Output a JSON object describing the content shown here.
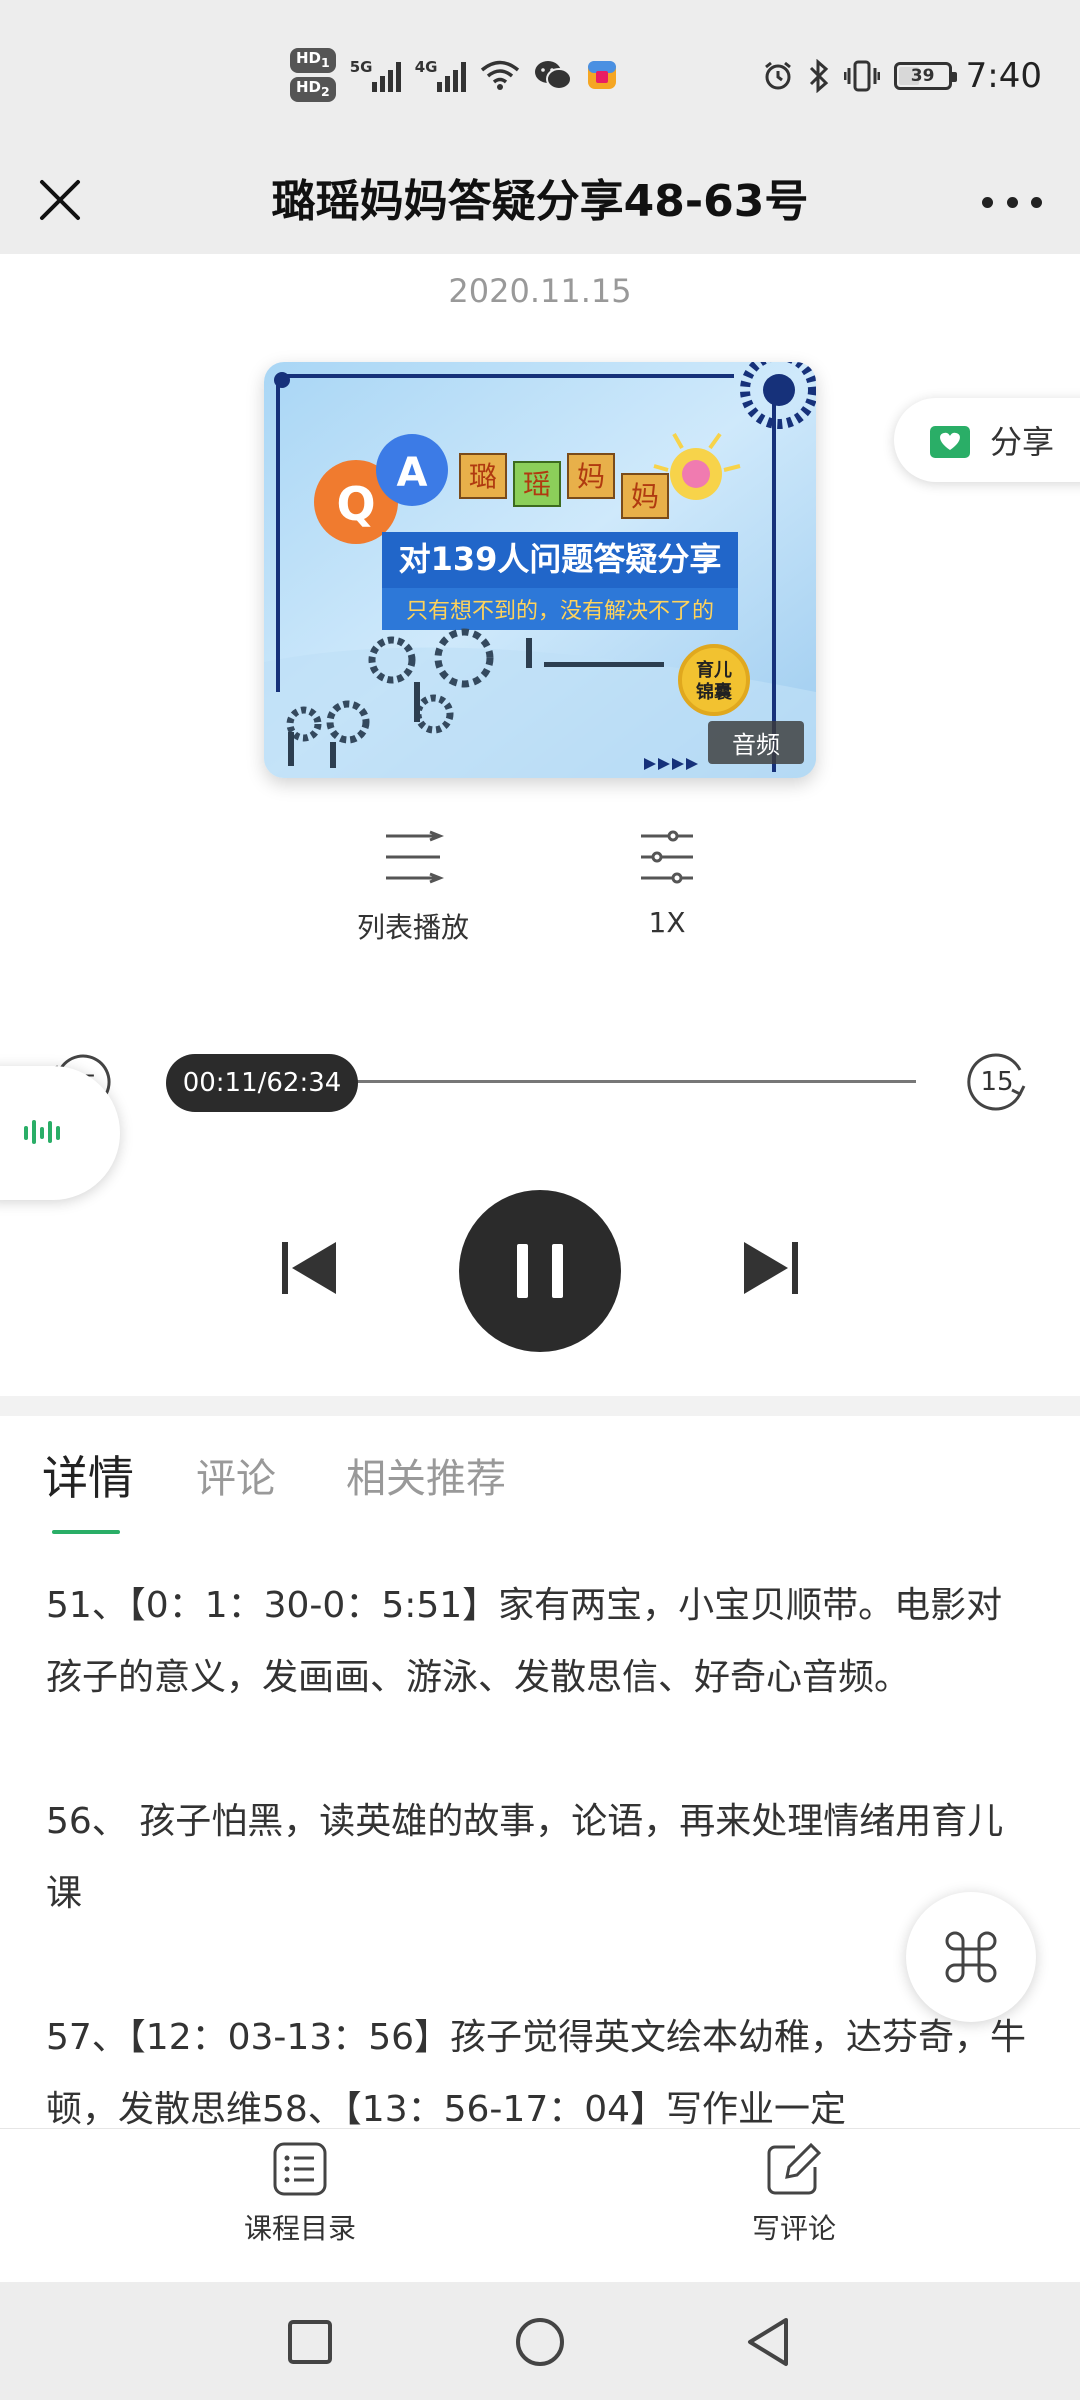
{
  "status_bar": {
    "hd1": "HD",
    "hd1_sub": "1",
    "hd2": "HD",
    "hd2_sub": "2",
    "net1": "5G",
    "net2": "4G",
    "battery": "39",
    "time": "7:40"
  },
  "header": {
    "title": "璐瑶妈妈答疑分享48-63号"
  },
  "episode": {
    "date": "2020.11.15",
    "cover": {
      "heading_chars": [
        "璐",
        "瑶",
        "妈",
        "妈"
      ],
      "subtitle": "对139人问题答疑分享",
      "tagline": "只有想不到的，没有解决不了的",
      "logo": "育儿\n锦囊",
      "badge": "音频",
      "q_letter": "Q",
      "a_letter": "A"
    }
  },
  "share": {
    "label": "分享"
  },
  "controls": {
    "list_label": "列表播放",
    "speed_label": "1X",
    "skip_back": "15",
    "skip_forward": "15",
    "time_display": "00:11/62:34",
    "progress": 0.003
  },
  "tabs": [
    {
      "label": "详情"
    },
    {
      "label": "评论"
    },
    {
      "label": "相关推荐"
    }
  ],
  "description": [
    "51、【0：1：30-0：5:51】家有两宝，小宝贝顺带。电影对孩子的意义，发画画、游泳、发散思信、好奇心音频。",
    "56、 孩子怕黑，读英雄的故事，论语，再来处理情绪用育儿课",
    "57、【12：03-13：56】孩子觉得英文绘本幼稚，达芬奇，牛顿，发散思维58、【13：56-17：04】写作业一定"
  ],
  "bottom_bar": {
    "catalog": "课程目录",
    "comment": "写评论"
  },
  "colors": {
    "accent_green": "#2aae67",
    "dark": "#2b2b2b"
  }
}
